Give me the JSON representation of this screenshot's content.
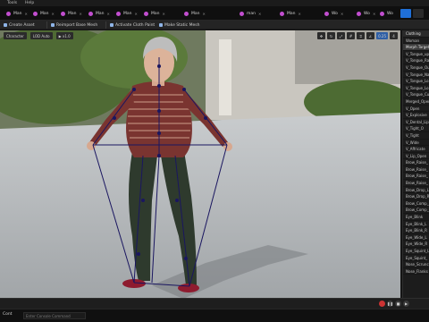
{
  "menu": [
    "Tools",
    "Help"
  ],
  "tabs": [
    {
      "label": "Man"
    },
    {
      "label": "Man"
    },
    {
      "label": "Man"
    },
    {
      "label": "Man"
    },
    {
      "label": "Man"
    },
    {
      "label": "Man"
    },
    {
      "label": "Man"
    },
    {
      "label": "man"
    },
    {
      "label": "Man"
    },
    {
      "label": "Wo"
    },
    {
      "label": "Wo"
    },
    {
      "label": "Wo"
    }
  ],
  "toolbar": {
    "create_asset": "Create Asset",
    "reimport": "Reimport Base Mesh",
    "activate_cloth": "Activate Cloth Paint",
    "make_static": "Make Static Mesh"
  },
  "viewport": {
    "character": "Character",
    "lod": "LOD Auto",
    "speed": "x1.0",
    "zoom_readout": "0.25",
    "fov_readout": "4"
  },
  "side_panel": {
    "title": "Clothing",
    "subtitle": "Woman",
    "section": "Morph Targets",
    "items": [
      "V_Tongue_up",
      "V_Tongue_Ra",
      "V_Tongue_Ou",
      "V_Tongue_Na",
      "V_Tongue_Lo",
      "V_Tongue_Lo",
      "V_Tongue_Cu",
      "Merged_Open",
      "V_Open",
      "V_Explosive",
      "V_Dental_Lip",
      "V_Tight_O",
      "V_Tight",
      "V_Wide",
      "V_Affricate",
      "V_Lip_Open",
      "Brow_Raise_",
      "Brow_Raise_",
      "Brow_Raise_",
      "Brow_Raise_",
      "Brow_Drop_L",
      "Brow_Drop_R",
      "Brow_Comp_",
      "Brow_Comp_",
      "Eye_Blink",
      "Eye_Blink_L",
      "Eye_Blink_R",
      "Eye_Wide_L",
      "Eye_Wide_R",
      "Eye_Squint_L",
      "Eye_Squint_",
      "Nose_Scrunc",
      "Nose_Flanks"
    ]
  },
  "status": {
    "drawer": "Cont",
    "cmd_placeholder": "Enter Console Command"
  },
  "colors": {
    "accent": "#1f6fd8",
    "tab_dot": "#c24ed0",
    "skeleton": "#1a1660",
    "record": "#cc3333"
  }
}
